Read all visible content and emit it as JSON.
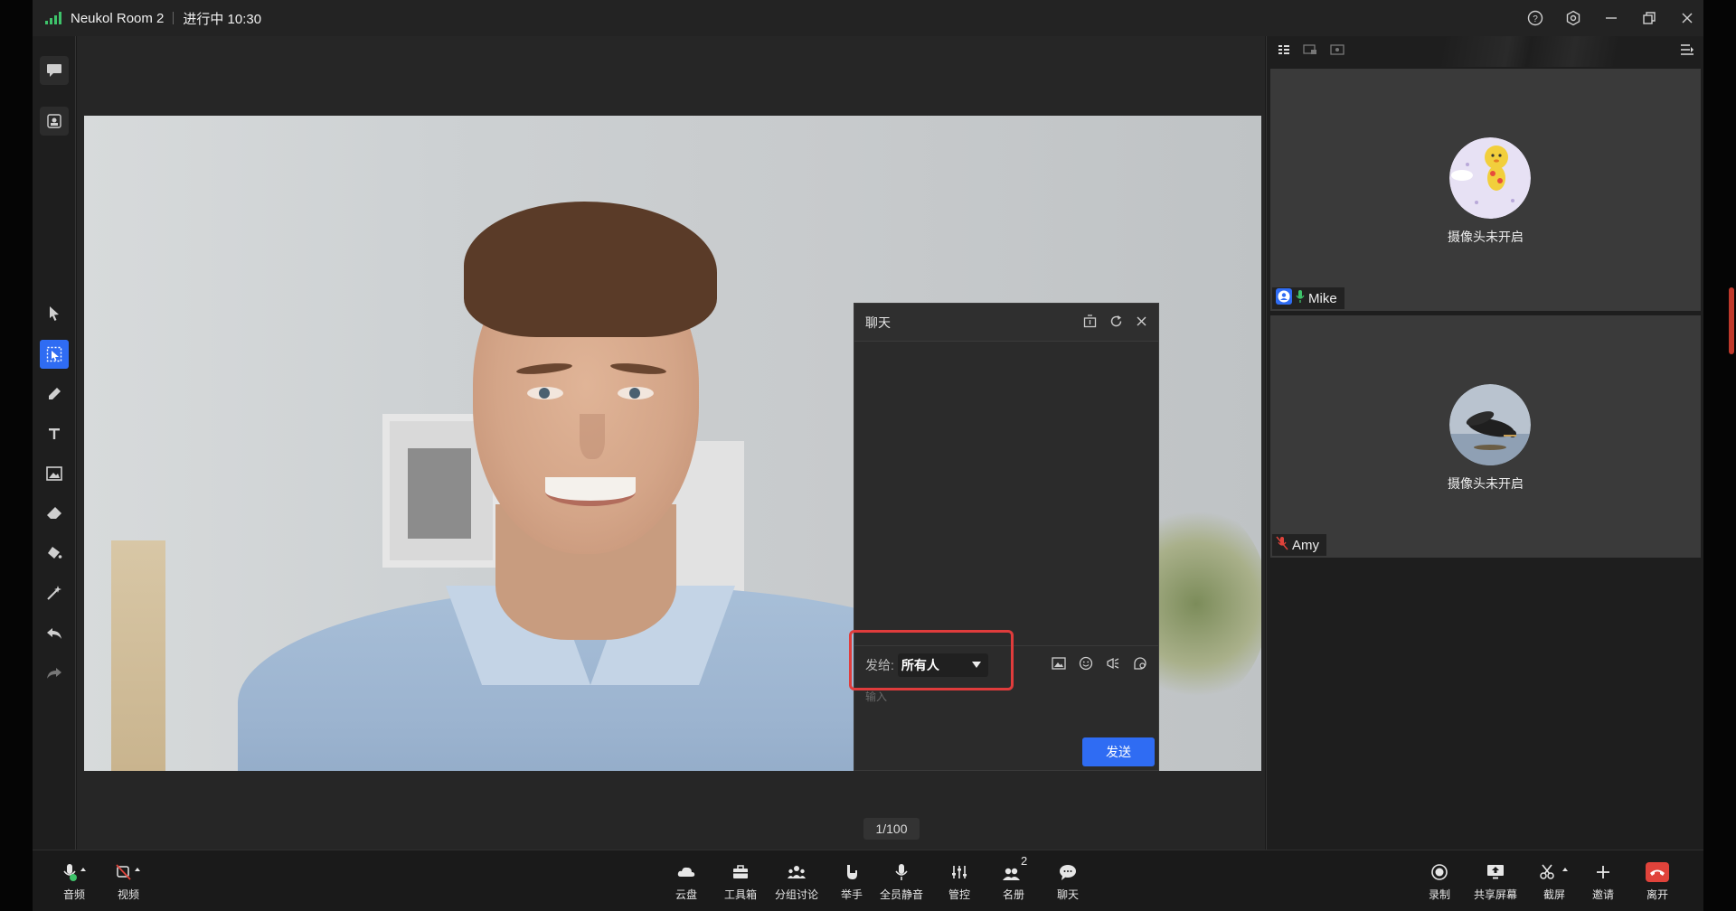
{
  "titlebar": {
    "app_title": "Neukol Room 2",
    "status": "进行中 10:30",
    "controls": [
      "help-icon",
      "settings-icon",
      "minimize-icon",
      "restore-icon",
      "close-icon"
    ]
  },
  "left_toolbar": {
    "tools": [
      "chat-bubble-icon",
      "screen-capture-icon",
      "pointer-icon",
      "select-icon",
      "pen-icon",
      "text-icon",
      "image-icon",
      "eraser-icon",
      "paint-bucket-icon",
      "magic-wand-icon",
      "undo-icon",
      "redo-icon"
    ],
    "active_tool": "select-icon"
  },
  "stage": {
    "page_indicator": "1/100"
  },
  "chat": {
    "title": "聊天",
    "send_to_label": "发给:",
    "recipient": "所有人",
    "input_placeholder": "输入",
    "send_button": "发送",
    "accent": "#2f6cf3"
  },
  "participants": [
    {
      "name": "Mike",
      "camera_status": "摄像头未开启",
      "mic": "on",
      "role_badge": "user-icon"
    },
    {
      "name": "Amy",
      "camera_status": "摄像头未开启",
      "mic": "muted"
    }
  ],
  "bottombar": {
    "left": [
      {
        "label": "音频",
        "icon": "microphone-icon"
      },
      {
        "label": "视频",
        "icon": "camera-off-icon"
      }
    ],
    "center": [
      {
        "label": "云盘",
        "icon": "cloud-icon"
      },
      {
        "label": "工具箱",
        "icon": "toolbox-icon"
      },
      {
        "label": "分组讨论",
        "icon": "group-icon"
      },
      {
        "label": "举手",
        "icon": "raise-hand-icon"
      },
      {
        "label": "全员静音",
        "icon": "mute-all-icon"
      },
      {
        "label": "管控",
        "icon": "sliders-icon"
      },
      {
        "label": "名册",
        "icon": "roster-icon",
        "badge": "2"
      },
      {
        "label": "聊天",
        "icon": "chat-icon"
      }
    ],
    "right": [
      {
        "label": "录制",
        "icon": "record-icon"
      },
      {
        "label": "共享屏幕",
        "icon": "share-screen-icon"
      },
      {
        "label": "截屏",
        "icon": "scissors-icon"
      },
      {
        "label": "邀请",
        "icon": "plus-icon"
      },
      {
        "label": "离开",
        "icon": "hangup-icon",
        "color": "#e0433b"
      }
    ]
  }
}
